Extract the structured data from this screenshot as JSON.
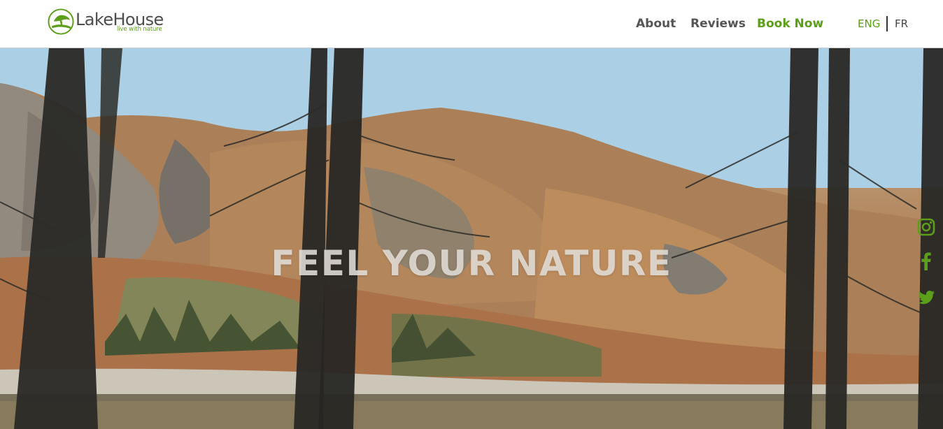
{
  "header": {
    "logo": {
      "name": "LakeHouse",
      "tagline": "live with nature"
    },
    "nav": {
      "about": "About",
      "reviews": "Reviews",
      "book_now": "Book Now"
    },
    "languages": {
      "active": "ENG",
      "other": "FR"
    }
  },
  "hero": {
    "title": "FEEL YOUR NATURE"
  },
  "social": {
    "icons": [
      "instagram-icon",
      "facebook-icon",
      "twitter-icon"
    ]
  },
  "colors": {
    "brand_green": "#5a9e1a",
    "nav_text": "#555555",
    "header_bg": "#ffffff"
  }
}
